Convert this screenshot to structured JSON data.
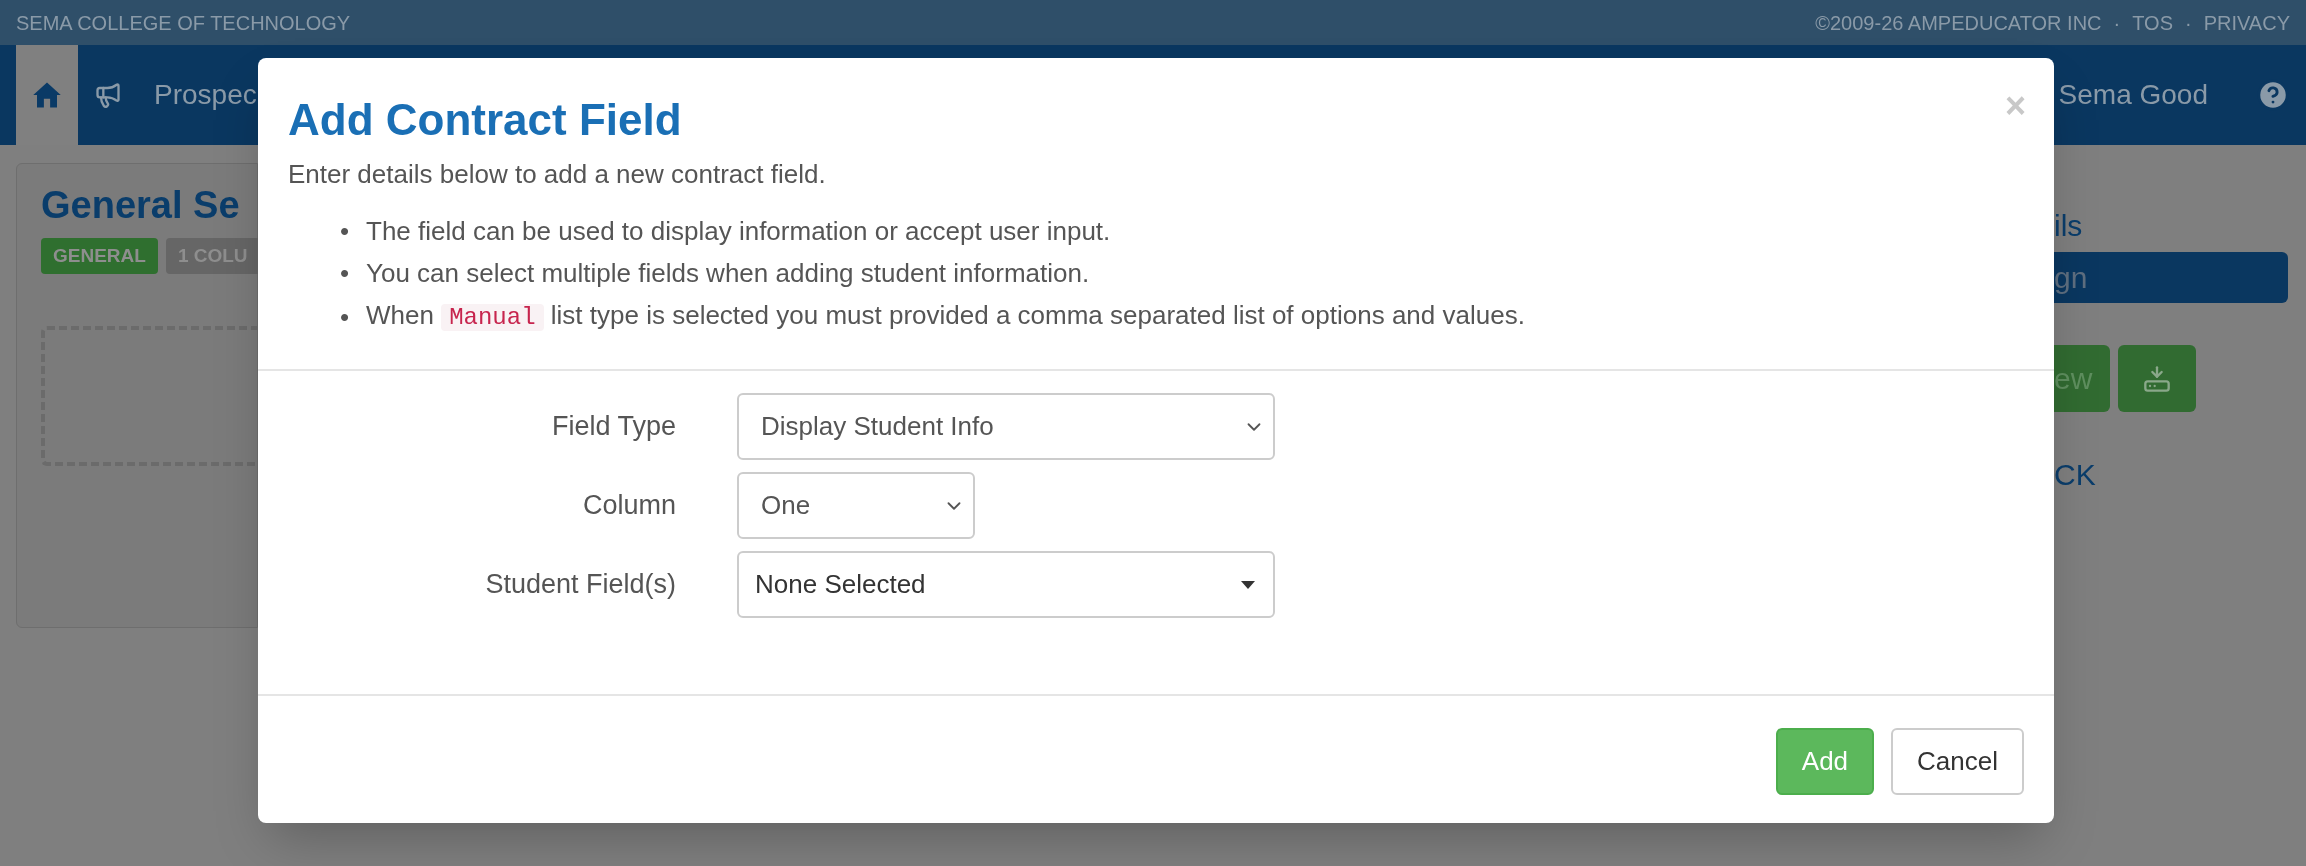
{
  "top_bar": {
    "school": "SEMA COLLEGE OF TECHNOLOGY",
    "links": [
      "©2009-26 AMPEDUCATOR INC",
      "TOS",
      "PRIVACY"
    ],
    "separator": "·"
  },
  "nav": {
    "items": [
      {
        "kind": "home",
        "selected": true
      },
      {
        "kind": "announcements",
        "selected": false
      },
      {
        "kind": "text",
        "label": "Prospec",
        "selected": false
      }
    ],
    "user": "Sema Good"
  },
  "page": {
    "title": "General Se",
    "badges": [
      {
        "label": "GENERAL",
        "color": "#2f6f2f"
      },
      {
        "label": "1 COLU",
        "color": "#666666"
      }
    ],
    "side_link": "ils",
    "side_bar_button": "gn",
    "side_buttons": [
      {
        "kind": "text",
        "label": "ew"
      },
      {
        "kind": "download"
      }
    ],
    "side_link_2": "CK"
  },
  "modal": {
    "title": "Add Contract Field",
    "close": "×",
    "intro": "Enter details below to add a new contract field.",
    "bullets": [
      {
        "marker": "•",
        "text": "The field can be used to display information or accept user input."
      },
      {
        "marker": "•",
        "text": "You can select multiple fields when adding student information."
      },
      {
        "marker": "•",
        "before": "When ",
        "code": "Manual",
        "after": " list type is selected you must provided a comma separated list of options and values."
      }
    ],
    "fields": [
      {
        "label": "Field Type",
        "kind": "select",
        "value": "Display Student Info"
      },
      {
        "label": "Column",
        "kind": "compact-select",
        "value": "One"
      },
      {
        "label": "Student Field(s)",
        "kind": "dropdown",
        "value": "None Selected"
      }
    ],
    "buttons": [
      {
        "label": "Add",
        "kind": "primary"
      },
      {
        "label": "Cancel",
        "kind": "default"
      }
    ]
  }
}
